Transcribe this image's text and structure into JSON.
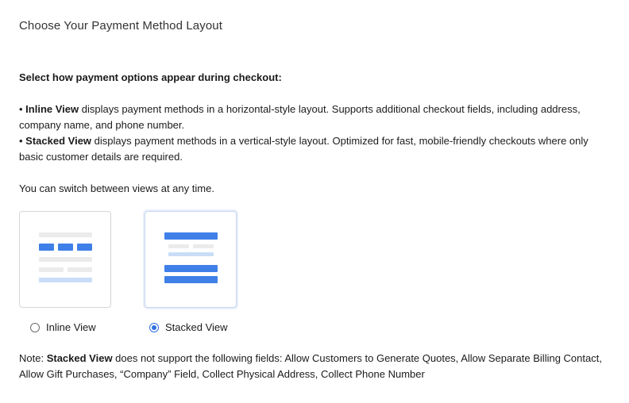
{
  "page": {
    "title": "Choose Your Payment Method Layout"
  },
  "description": {
    "heading": "Select how payment options appear during checkout:",
    "inline": {
      "bullet": "• ",
      "name": "Inline View",
      "text": " displays payment methods in a horizontal-style layout. Supports additional checkout fields, including address, company name, and phone number."
    },
    "stacked": {
      "bullet": "• ",
      "name": "Stacked View",
      "text": " displays payment methods in a vertical-style layout. Optimized for fast, mobile-friendly checkouts where only basic customer details are required."
    },
    "switch_text": "You can switch between views at any time."
  },
  "options": {
    "inline": {
      "label": "Inline View",
      "selected": false
    },
    "stacked": {
      "label": "Stacked View",
      "selected": true
    }
  },
  "note": {
    "prefix": "Note: ",
    "name": "Stacked View",
    "text": " does not support the following fields: Allow Customers to Generate Quotes, Allow Separate Billing Contact, Allow Gift Purchases, “Company” Field, Collect Physical Address, Collect Phone Number"
  },
  "colors": {
    "accent": "#3f7fe8",
    "placeholder_gray": "#ebebeb",
    "light_blue": "#c9ddf7"
  }
}
